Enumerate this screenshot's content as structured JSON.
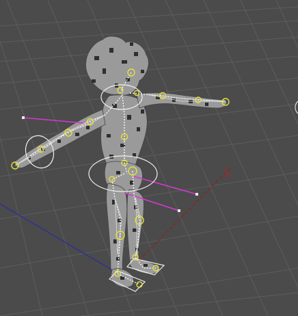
{
  "viewport": {
    "background": "#4b4b4b",
    "grid_color": "#5e5e5e",
    "x_axis_color": "#8e2222",
    "y_axis_color": "#2a2ea0",
    "mesh_color": "#9c9c9c",
    "mesh_dark": "#2f2f2f",
    "bone_color": "#ffffff",
    "joint_color": "#e6e03a",
    "ik_line_color": "#d23ad2"
  },
  "icons": {
    "joint": "yellow-circle-icon",
    "controller": "white-ellipse-icon"
  }
}
